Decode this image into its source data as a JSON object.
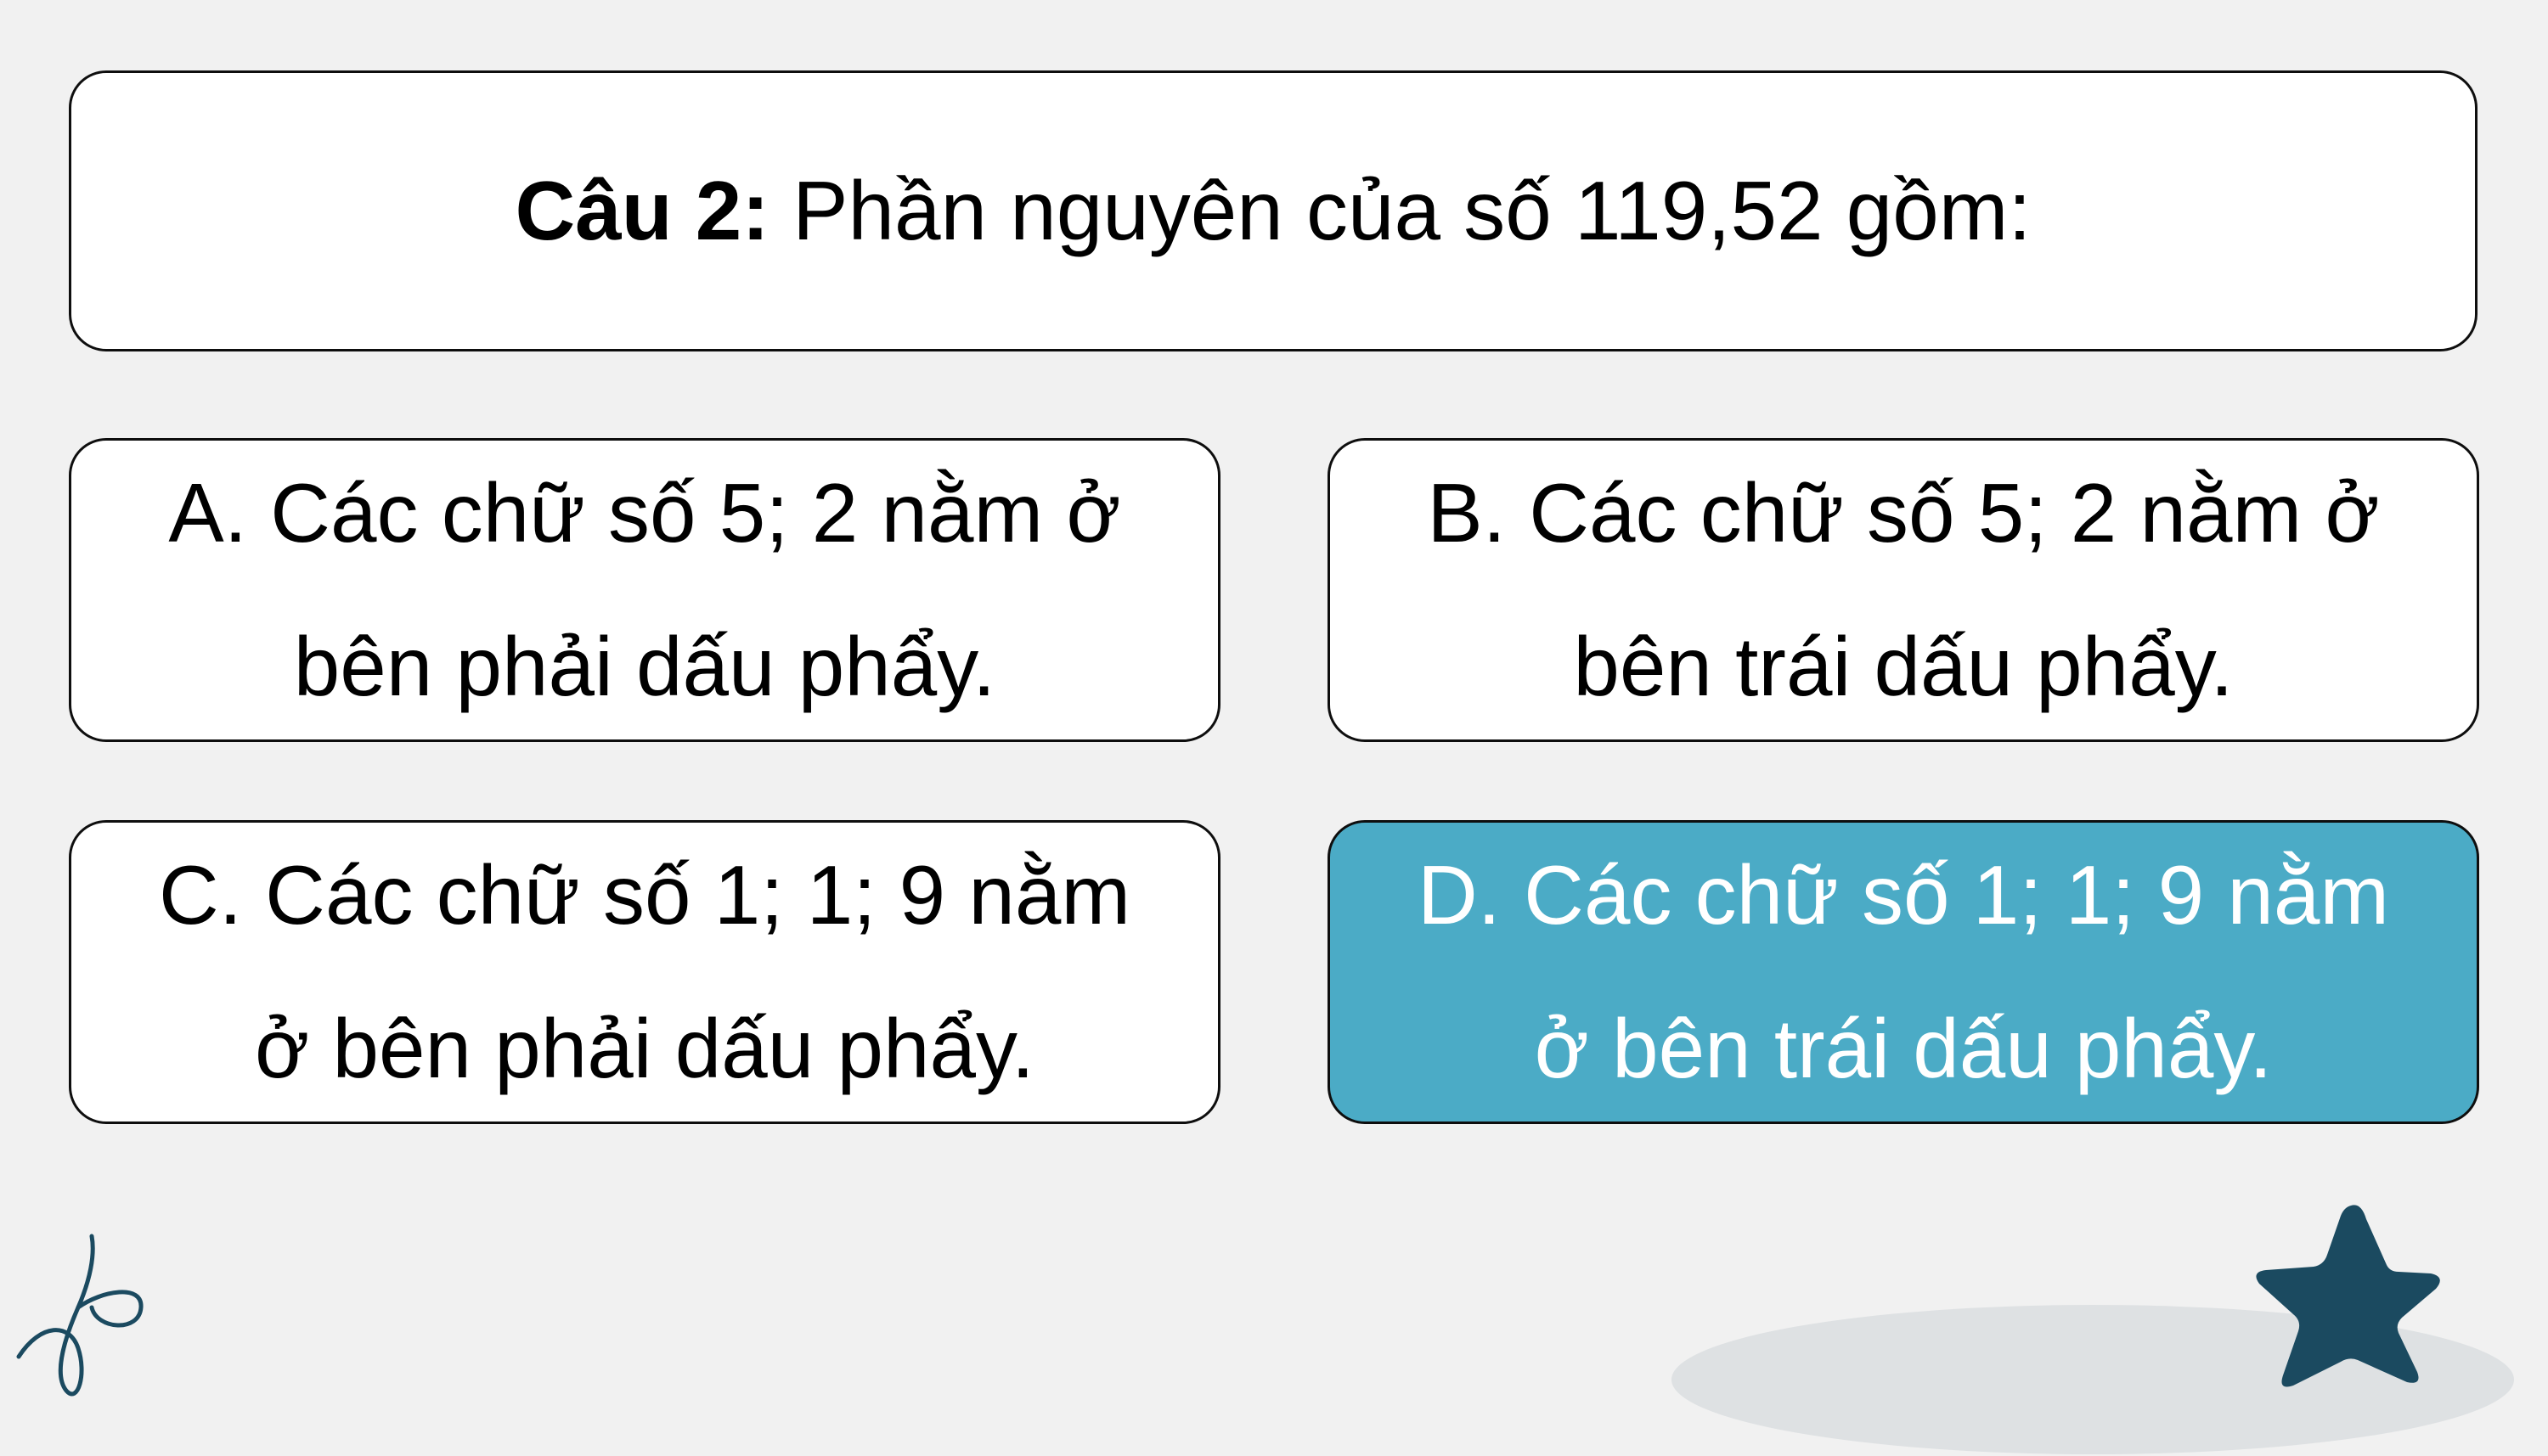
{
  "question": {
    "prefix": "Câu 2:",
    "text": " Phần nguyên của số 119,52 gồm:"
  },
  "answers": [
    {
      "label": "A. Các chữ số 5; 2 nằm ở bên phải dấu phẩy.",
      "selected": false
    },
    {
      "label": "B. Các chữ số 5; 2 nằm ở bên trái dấu phẩy.",
      "selected": false
    },
    {
      "label": "C. Các chữ số 1; 1; 9 nằm ở bên phải dấu phẩy.",
      "selected": false
    },
    {
      "label": "D. Các chữ số 1; 1; 9 nằm ở bên trái dấu phẩy.",
      "selected": true
    }
  ],
  "colors": {
    "background": "#f1f1f1",
    "selected_answer": "#4babc6",
    "star": "#1b4a60",
    "scribble": "#1b4a60",
    "ellipse": "#dee1e3"
  },
  "decorations": {
    "star_icon": "star-icon",
    "scribble_icon": "scribble-icon"
  }
}
